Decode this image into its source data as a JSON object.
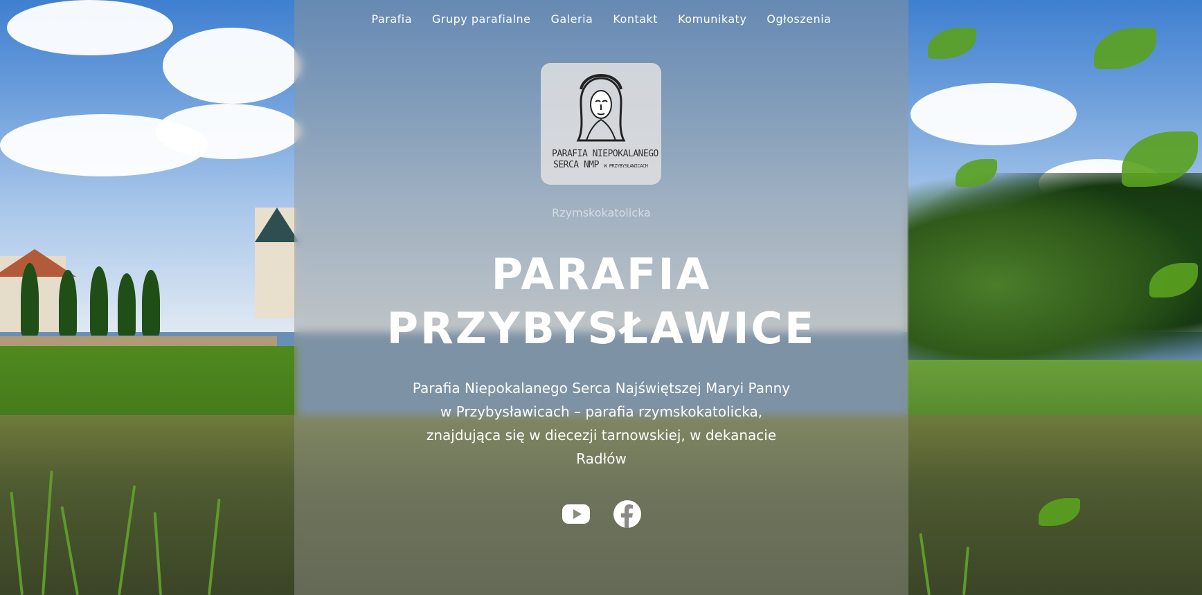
{
  "nav": {
    "items": [
      "Parafia",
      "Grupy parafialne",
      "Galeria",
      "Kontakt",
      "Komunikaty",
      "Ogłoszenia"
    ]
  },
  "logo": {
    "line1": "PARAFIA NIEPOKALANEGO",
    "line2": "SERCA NMP",
    "line2_small": "W PRZYBYSŁAWICACH"
  },
  "hero": {
    "rite": "Rzymskokatolicka",
    "title_line1": "PARAFIA",
    "title_line2": "PRZYBYSŁAWICE",
    "description": "Parafia Niepokalanego Serca Najświętszej Maryi Panny w Przybysławicach – parafia rzymskokatolicka, znajdująca się w diecezji tarnowskiej, w dekanacie Radłów"
  },
  "social": {
    "icons": [
      "youtube-icon",
      "facebook-icon"
    ]
  },
  "colors": {
    "text": "#ffffff",
    "panel": "rgba(150,150,145,0.45)",
    "logo_bg": "#e1e1e1"
  }
}
